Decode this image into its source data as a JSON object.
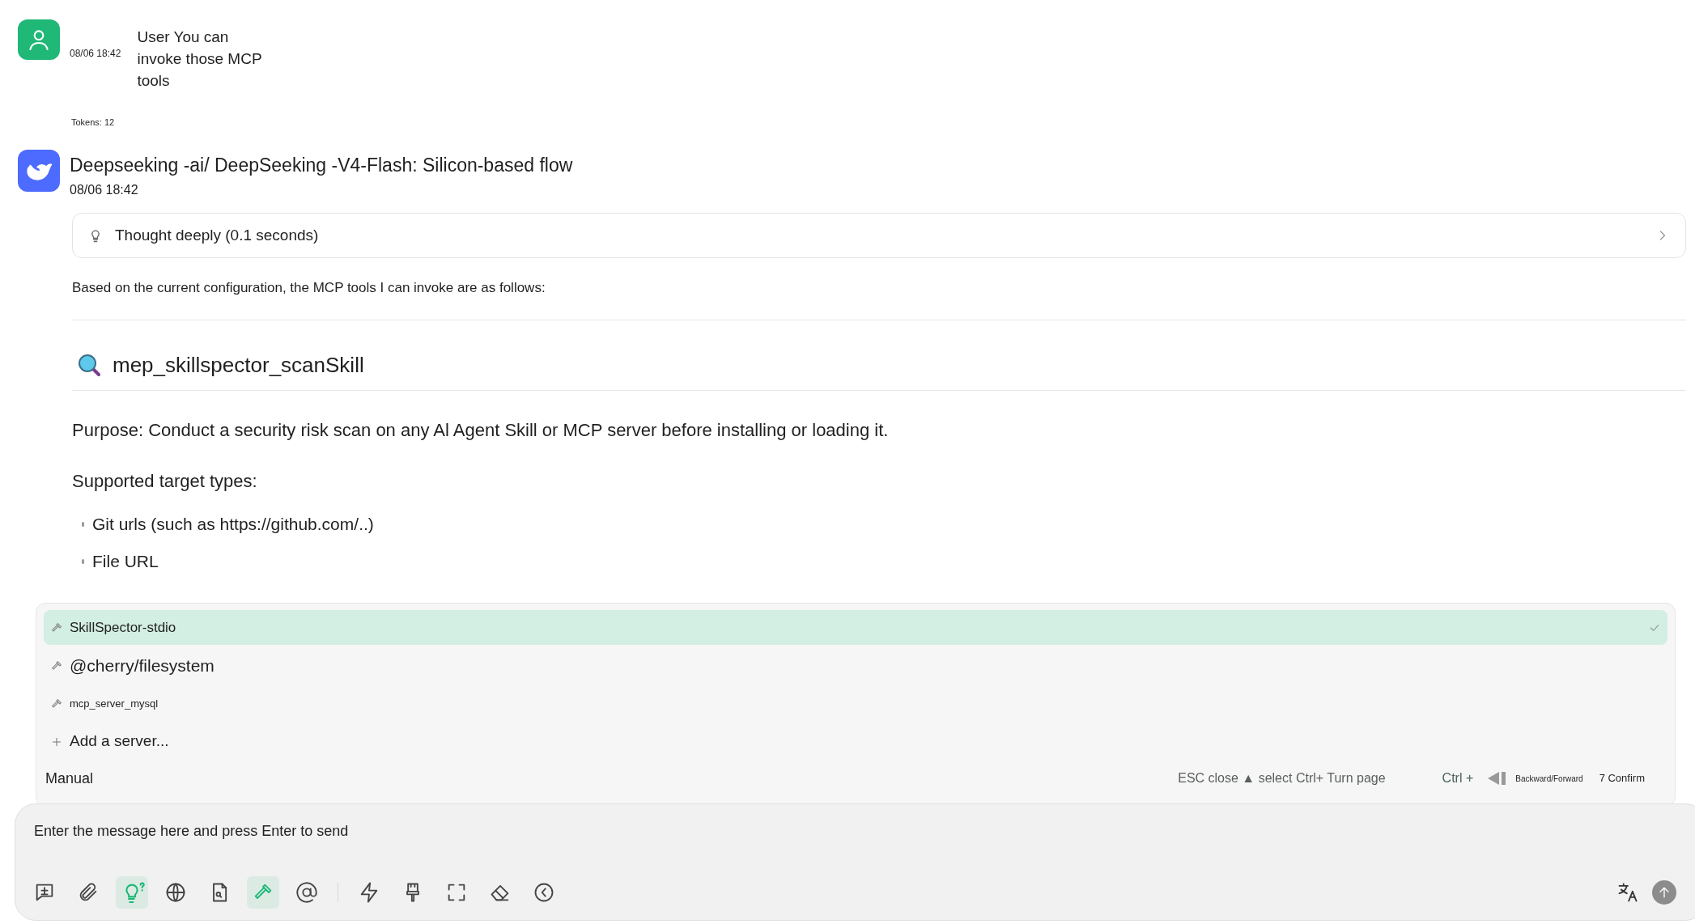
{
  "user_message": {
    "date": "08/06 18:42",
    "text": "User You can invoke those MCP tools",
    "tokens": "Tokens: 12"
  },
  "assistant_message": {
    "title": "Deepseeking -ai/ DeepSeeking -V4-Flash: Silicon-based flow",
    "date": "08/06 18:42",
    "thought": {
      "label": "Thought deeply (0.1 seconds)",
      "expanded": false
    },
    "intro": "Based on the current configuration, the MCP tools I can invoke are as follows:",
    "tool_heading": "mep_skillspector_scanSkill",
    "purpose": "Purpose: Conduct a security risk scan on any Al Agent Skill or MCP server before installing or loading it.",
    "supported_heading": "Supported target types:",
    "list_items": [
      "Git urls (such as https://github.com/..)",
      "File URL"
    ]
  },
  "server_menu": {
    "items": [
      {
        "kind": "server",
        "label": "SkillSpector-stdio",
        "selected": true
      },
      {
        "kind": "server",
        "label": "@cherry/filesystem",
        "selected": false
      },
      {
        "kind": "server",
        "label": "mcp_server_mysql",
        "selected": false
      },
      {
        "kind": "add",
        "label": "Add a server...",
        "selected": false
      }
    ],
    "mode": "Manual",
    "hint": "ESC close ▲ select Ctrl+ Turn page",
    "key_hint": "Ctrl +",
    "nav_hint": "Backward/Forward",
    "confirm_hint": "7 Confirm"
  },
  "composer": {
    "placeholder": "Enter the message here and press Enter to send",
    "tool_groups": [
      [
        {
          "kind": "topic",
          "active": false
        },
        {
          "kind": "attach",
          "active": false
        },
        {
          "kind": "think",
          "active": true
        },
        {
          "kind": "web",
          "active": false
        },
        {
          "kind": "knowledge",
          "active": false
        },
        {
          "kind": "mcp",
          "active": true
        },
        {
          "kind": "mention",
          "active": false
        }
      ],
      [
        {
          "kind": "quick",
          "active": false
        },
        {
          "kind": "clear",
          "active": false
        },
        {
          "kind": "expand",
          "active": false
        },
        {
          "kind": "eraser",
          "active": false
        },
        {
          "kind": "collapse",
          "active": false
        }
      ]
    ]
  }
}
